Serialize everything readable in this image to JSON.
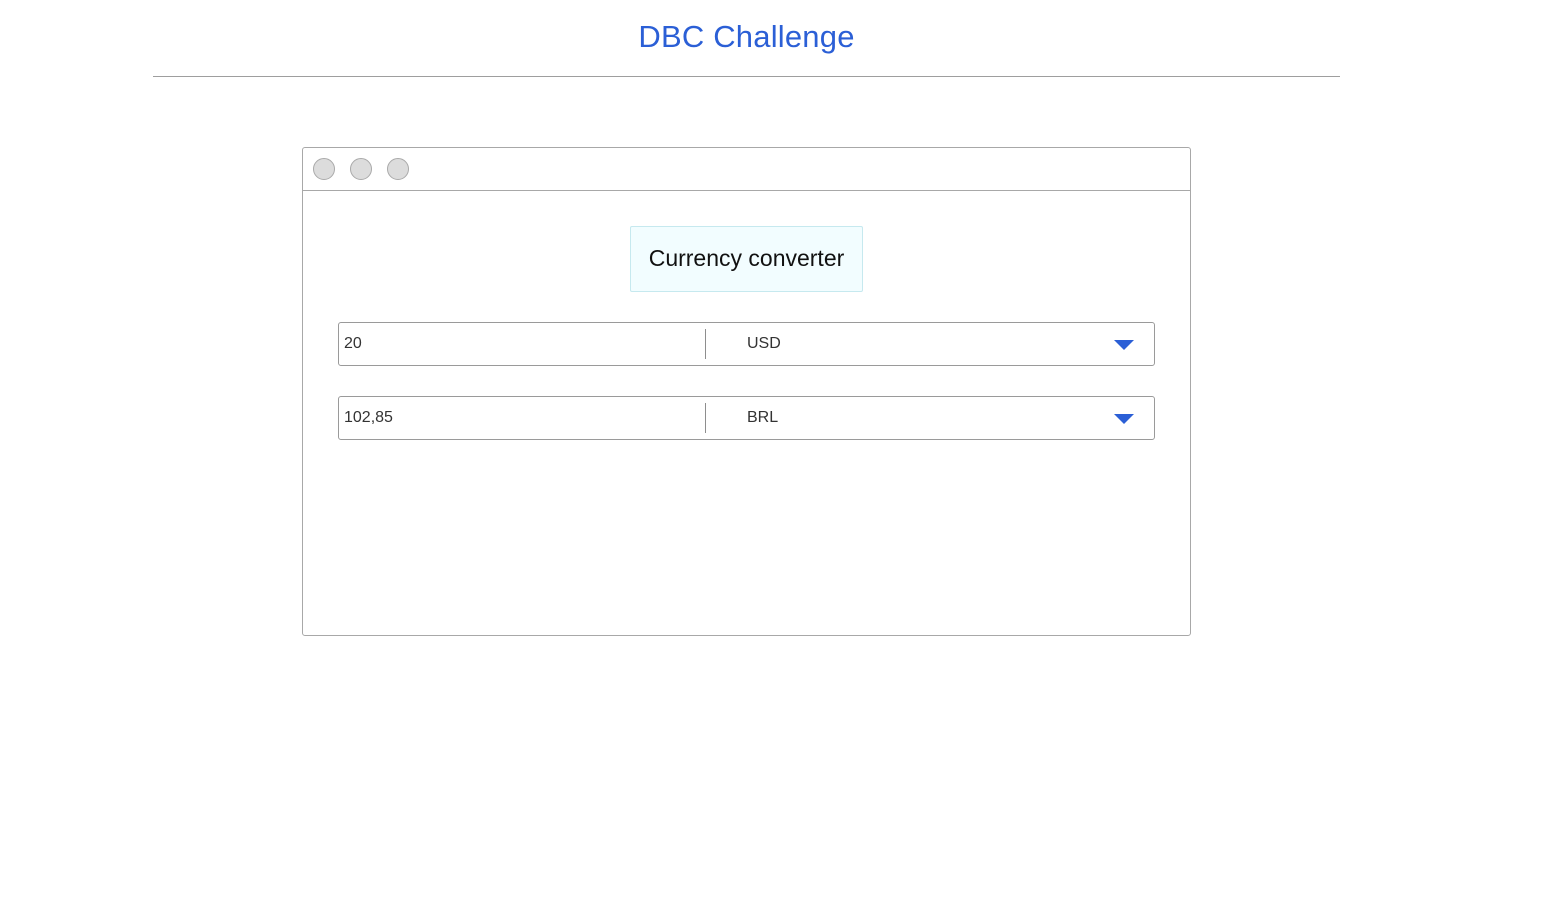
{
  "header": {
    "title": "DBC Challenge"
  },
  "converter": {
    "title": "Currency converter",
    "rows": [
      {
        "amount": "20",
        "currency": "USD"
      },
      {
        "amount": "102,85",
        "currency": "BRL"
      }
    ]
  },
  "colors": {
    "accent": "#2b5fd6",
    "title_bg": "#f2fdff",
    "border": "#a8a8a8"
  },
  "icons": {
    "window_buttons": [
      "window-dot-icon",
      "window-dot-icon",
      "window-dot-icon"
    ],
    "dropdown": "chevron-down-icon"
  }
}
